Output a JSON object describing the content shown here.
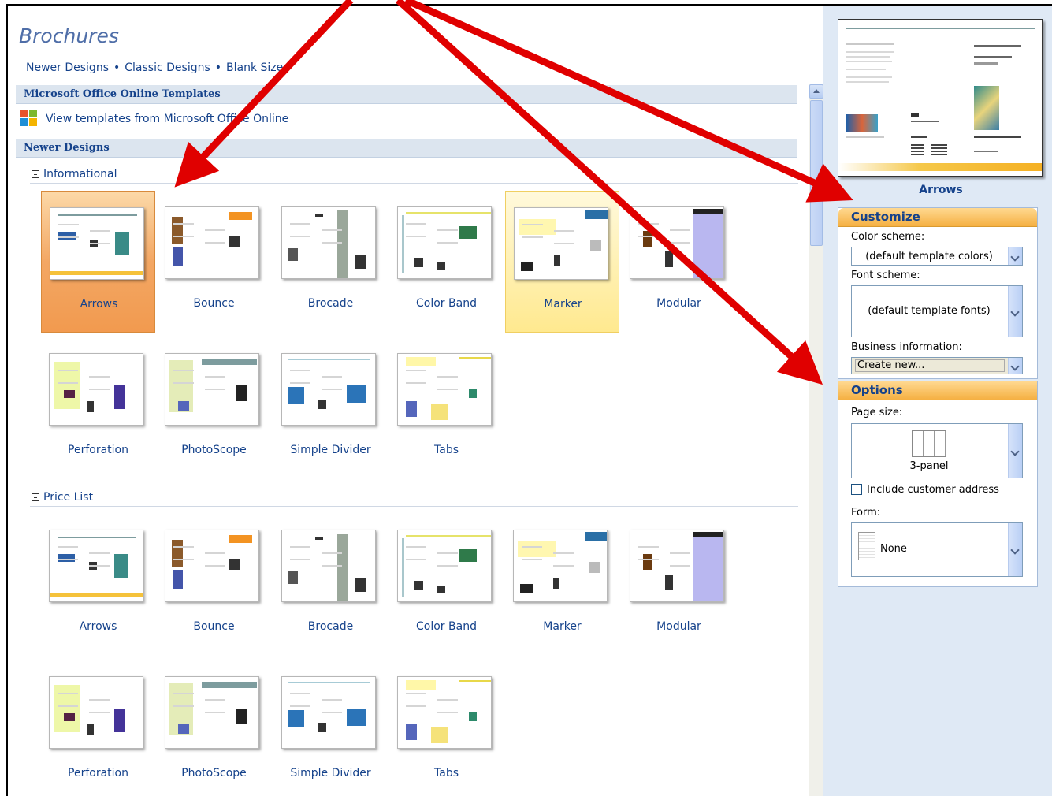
{
  "gallery": {
    "title": "Brochures",
    "quicklinks": [
      "Newer Designs",
      "Classic Designs",
      "Blank Sizes"
    ],
    "online_band": "Microsoft Office Online Templates",
    "online_link": "View templates from Microsoft Office Online",
    "newer_band": "Newer Designs",
    "groups": [
      {
        "title": "Informational",
        "items": [
          "Arrows",
          "Bounce",
          "Brocade",
          "Color Band",
          "Marker",
          "Modular",
          "Perforation",
          "PhotoScope",
          "Simple Divider",
          "Tabs"
        ]
      },
      {
        "title": "Price List",
        "items": [
          "Arrows",
          "Bounce",
          "Brocade",
          "Color Band",
          "Marker",
          "Modular",
          "Perforation",
          "PhotoScope",
          "Simple Divider",
          "Tabs"
        ]
      }
    ],
    "selected": "Arrows",
    "hovered": "Marker"
  },
  "panel": {
    "preview_name": "Arrows",
    "customize": {
      "title": "Customize",
      "color_label": "Color scheme:",
      "color_value": "(default template colors)",
      "font_label": "Font scheme:",
      "font_value": "(default template fonts)",
      "business_label": "Business information:",
      "business_value": "Create new..."
    },
    "options": {
      "title": "Options",
      "page_size_label": "Page size:",
      "page_size_value": "3-panel",
      "address_label": "Include customer address",
      "form_label": "Form:",
      "form_value": "None"
    }
  },
  "colors": {
    "accent_orange": "#f5b042",
    "link_blue": "#15428b",
    "annotation_red": "#e00000"
  }
}
